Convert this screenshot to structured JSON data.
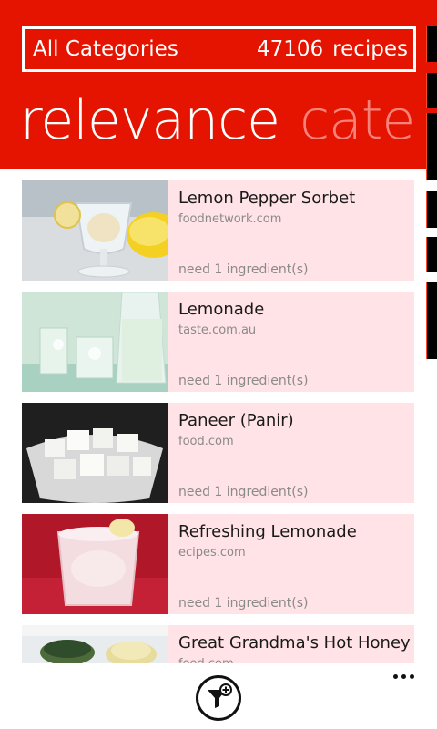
{
  "header": {
    "category": "All Categories",
    "count": "47106",
    "count_unit": "recipes",
    "pivot_active": "relevance",
    "pivot_next": "cate"
  },
  "recipes": [
    {
      "title": "Lemon Pepper Sorbet",
      "source": "foodnetwork.com",
      "need": "need 1 ingredient(s)",
      "image": "sorbet-glass-photo"
    },
    {
      "title": "Lemonade",
      "source": "taste.com.au",
      "need": "need 1 ingredient(s)",
      "image": "lemonade-pitcher-photo"
    },
    {
      "title": "Paneer (Panir)",
      "source": "food.com",
      "need": "need 1 ingredient(s)",
      "image": "paneer-bowl-photo"
    },
    {
      "title": "Refreshing Lemonade",
      "source": "ecipes.com",
      "need": "need 1 ingredient(s)",
      "image": "lemonade-glass-photo"
    },
    {
      "title": "Great Grandma's Hot Honey Lem",
      "source": "food.com",
      "need": "",
      "image": "honey-jars-photo"
    }
  ],
  "app_bar": {
    "filter_icon": "filter-add-icon",
    "more_icon": "ellipsis-icon"
  },
  "colors": {
    "accent": "#e51400",
    "accent_faded": "#f6837a",
    "row_bg": "#ffe3e6"
  }
}
